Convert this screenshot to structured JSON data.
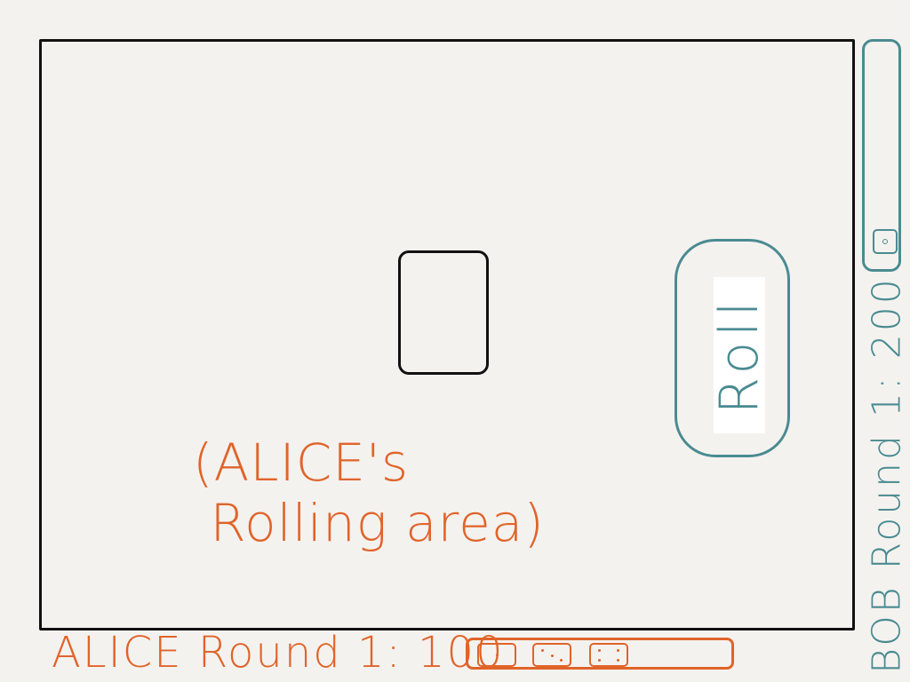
{
  "alice": {
    "area_label": "(ALICE's\n Rolling area)",
    "status_label": "ALICE Round 1: 100",
    "tray_dice_count": 3
  },
  "bob": {
    "status_label": "BOB Round 1: 200"
  },
  "roll_button": {
    "label": "Roll"
  },
  "colors": {
    "alice": "#e0642a",
    "bob": "#4a8b91",
    "frame": "#111111",
    "background": "#f4f2ef"
  }
}
